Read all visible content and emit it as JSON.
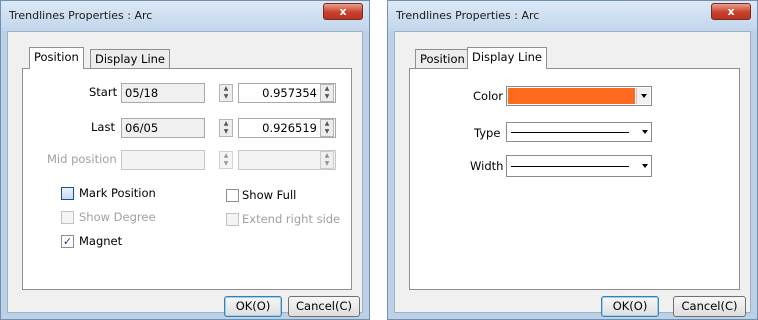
{
  "left_dialog": {
    "title": "Trendlines Properties : Arc",
    "close_glyph": "x",
    "tabs": [
      {
        "label": "Position",
        "active": true
      },
      {
        "label": "Display Line",
        "active": false
      }
    ],
    "start": {
      "label": "Start",
      "date": "05/18",
      "value": "0.957354"
    },
    "last": {
      "label": "Last",
      "date": "06/05",
      "value": "0.926519"
    },
    "mid": {
      "label": "Mid position",
      "date": "",
      "value": ""
    },
    "checkboxes": {
      "mark_position": {
        "label": "Mark Position",
        "checked": false,
        "enabled": true
      },
      "show_degree": {
        "label": "Show Degree",
        "checked": false,
        "enabled": false
      },
      "magnet": {
        "label": "Magnet",
        "checked": true,
        "enabled": true
      },
      "show_full": {
        "label": "Show Full",
        "checked": false,
        "enabled": true
      },
      "extend_right": {
        "label": "Extend right side",
        "checked": false,
        "enabled": false
      }
    },
    "ok_label": "OK(O)",
    "cancel_label": "Cancel(C)"
  },
  "right_dialog": {
    "title": "Trendlines Properties : Arc",
    "close_glyph": "x",
    "tabs": [
      {
        "label": "Position",
        "active": false
      },
      {
        "label": "Display Line",
        "active": true
      }
    ],
    "color_label": "Color",
    "color_value": "#ff6a21",
    "type_label": "Type",
    "width_label": "Width",
    "ok_label": "OK(O)",
    "cancel_label": "Cancel(C)"
  },
  "icons": {
    "spin_up": "▲",
    "spin_down": "▼",
    "check": "✓"
  }
}
